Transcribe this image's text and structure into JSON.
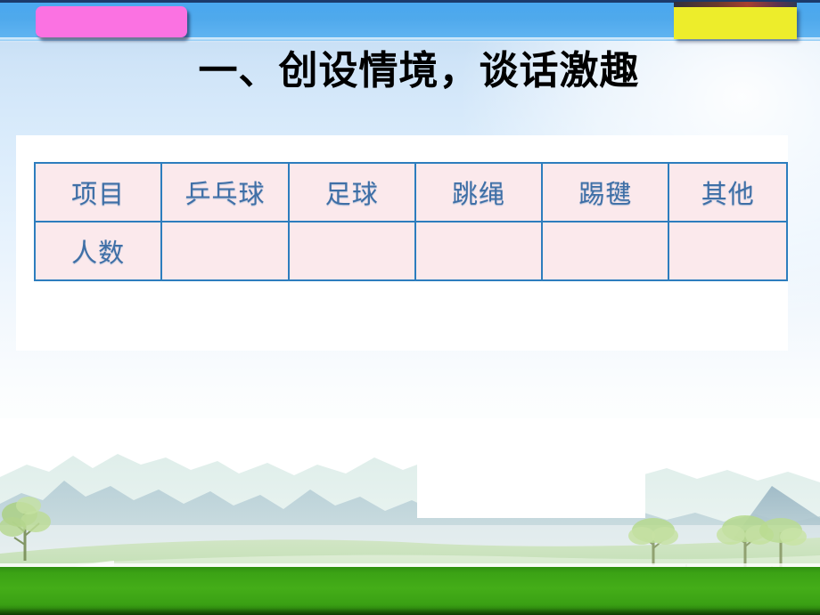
{
  "slide": {
    "title": "一、创设情境，谈话激趣",
    "accent_blue": "#4aa8ef",
    "chip_pink_color": "#fb72e2",
    "chip_yellow_color": "#eded2b",
    "table_border_color": "#2d7dbe",
    "table_cell_bg": "#fbe9ec",
    "table_text_color": "#3f6fa6",
    "grass_color": "#44ad18"
  },
  "table": {
    "row_labels": [
      "项目",
      "人数"
    ],
    "columns": [
      "乒乓球",
      "足球",
      "跳绳",
      "踢毽",
      "其他"
    ],
    "rows": [
      {
        "label": "项目",
        "cells": [
          "乒乓球",
          "足球",
          "跳绳",
          "踢毽",
          "其他"
        ]
      },
      {
        "label": "人数",
        "cells": [
          "",
          "",
          "",
          "",
          ""
        ]
      }
    ]
  }
}
